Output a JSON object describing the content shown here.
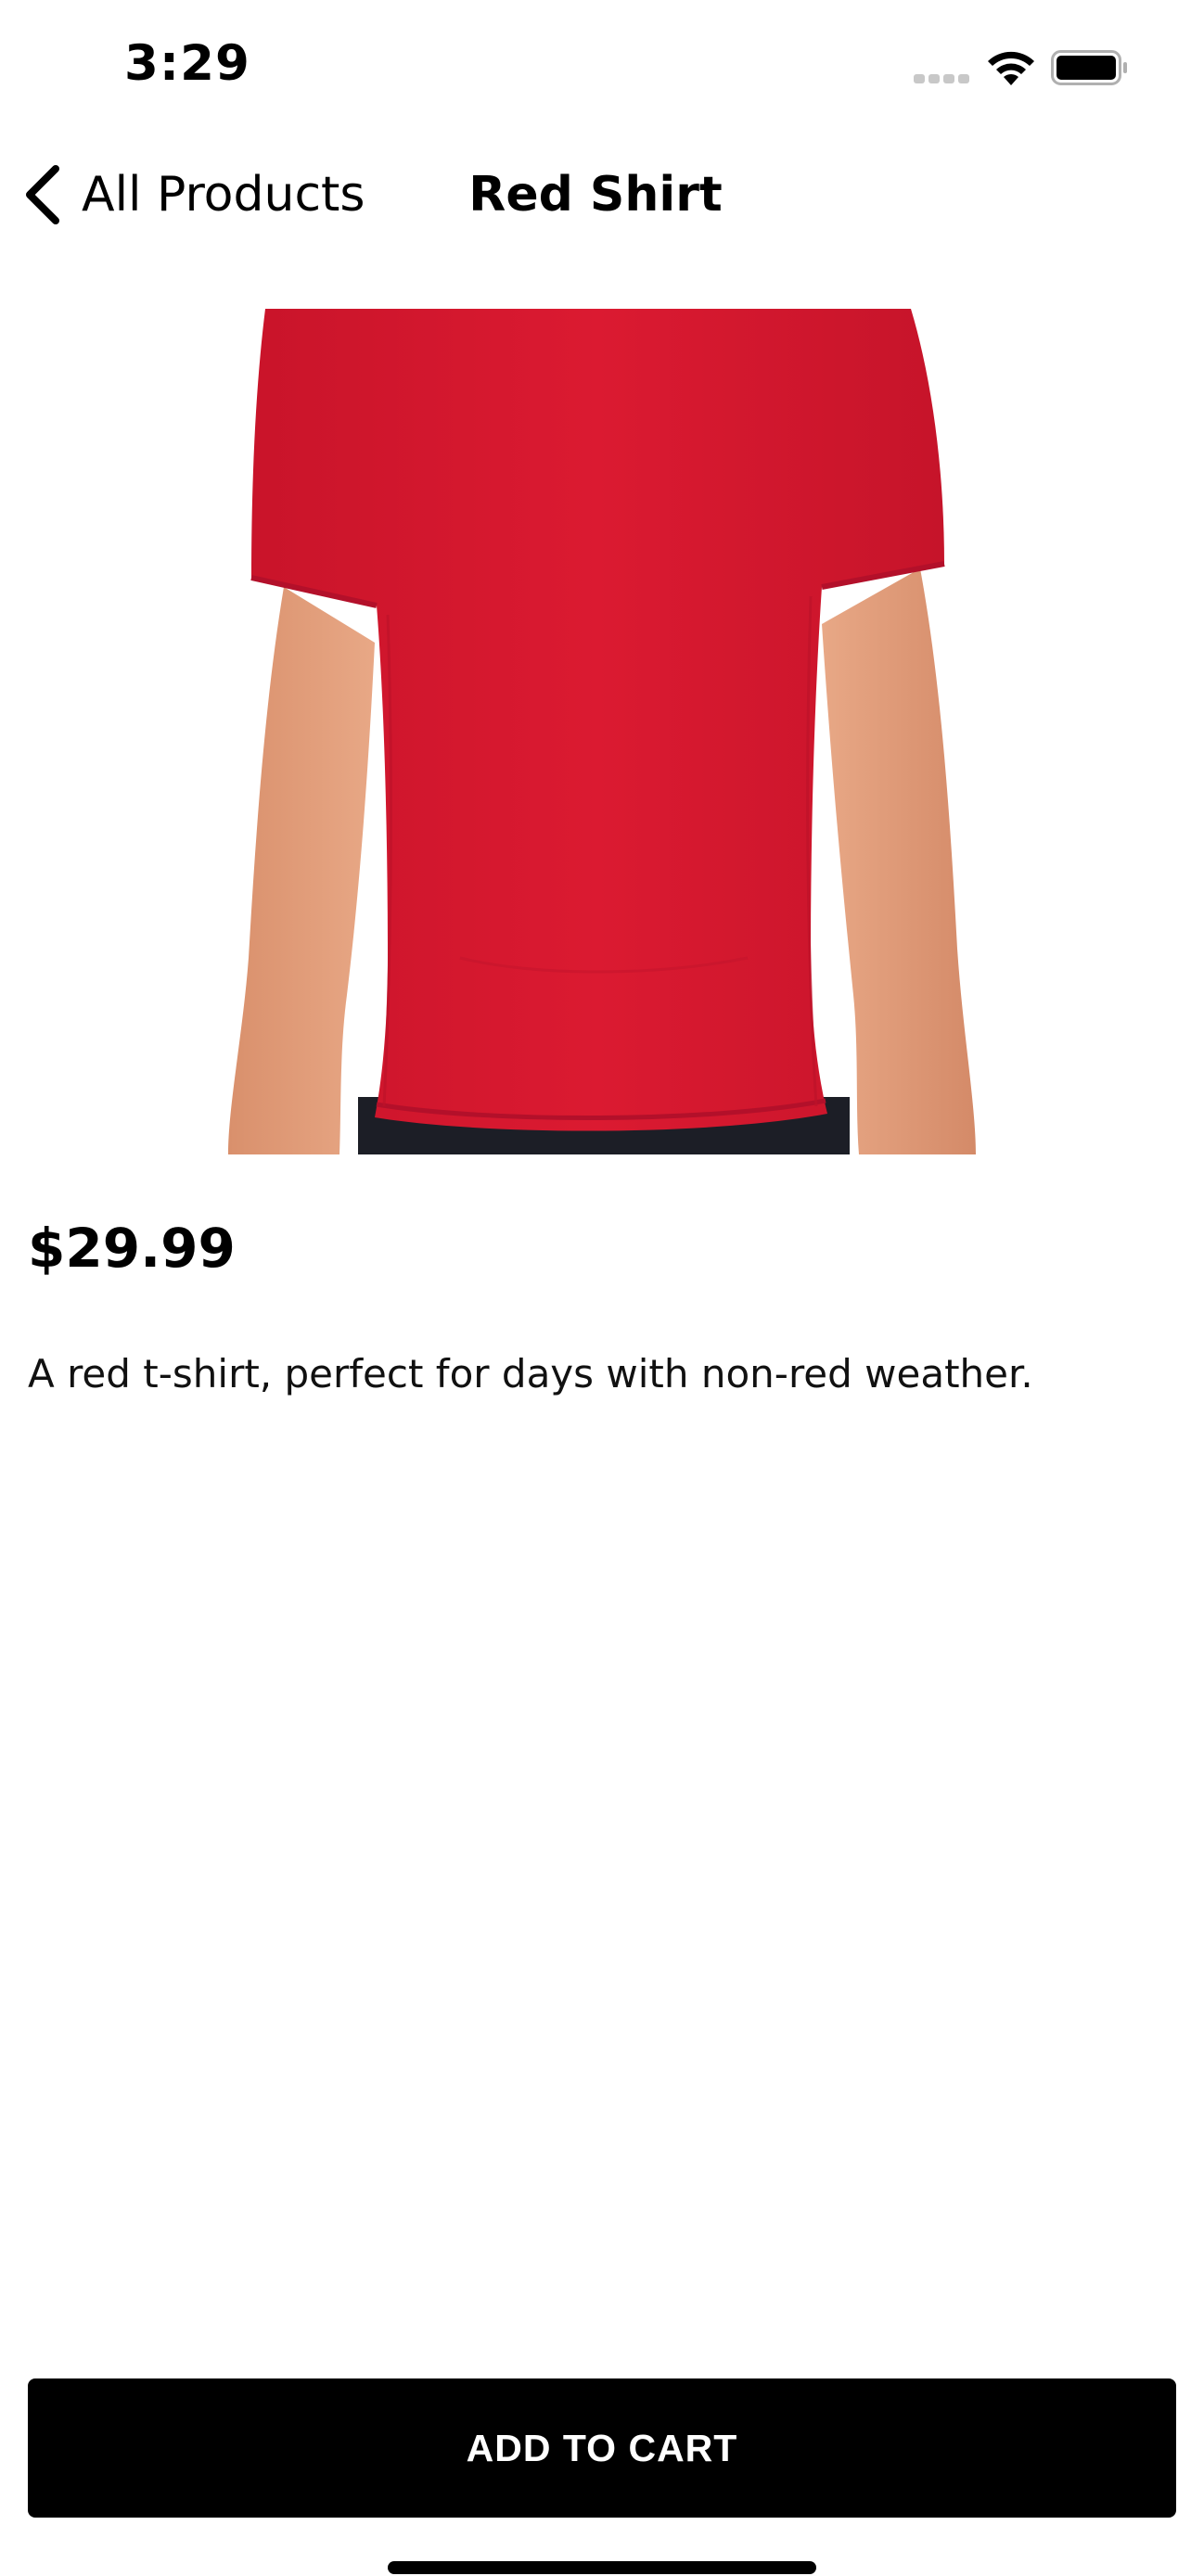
{
  "status_bar": {
    "time": "3:29",
    "signal_icon": "cellular-signal-icon",
    "wifi_icon": "wifi-icon",
    "battery_icon": "battery-icon"
  },
  "nav": {
    "back_icon": "chevron-left-icon",
    "back_label": "All Products",
    "title": "Red Shirt"
  },
  "product": {
    "image_subject": "red t-shirt",
    "price": "$29.99",
    "description": "A red t-shirt, perfect for days with non-red weather."
  },
  "actions": {
    "add_to_cart_label": "ADD TO CART"
  },
  "colors": {
    "shirt_red": "#D7182E",
    "button_bg": "#000000",
    "button_text": "#FFFFFF"
  }
}
